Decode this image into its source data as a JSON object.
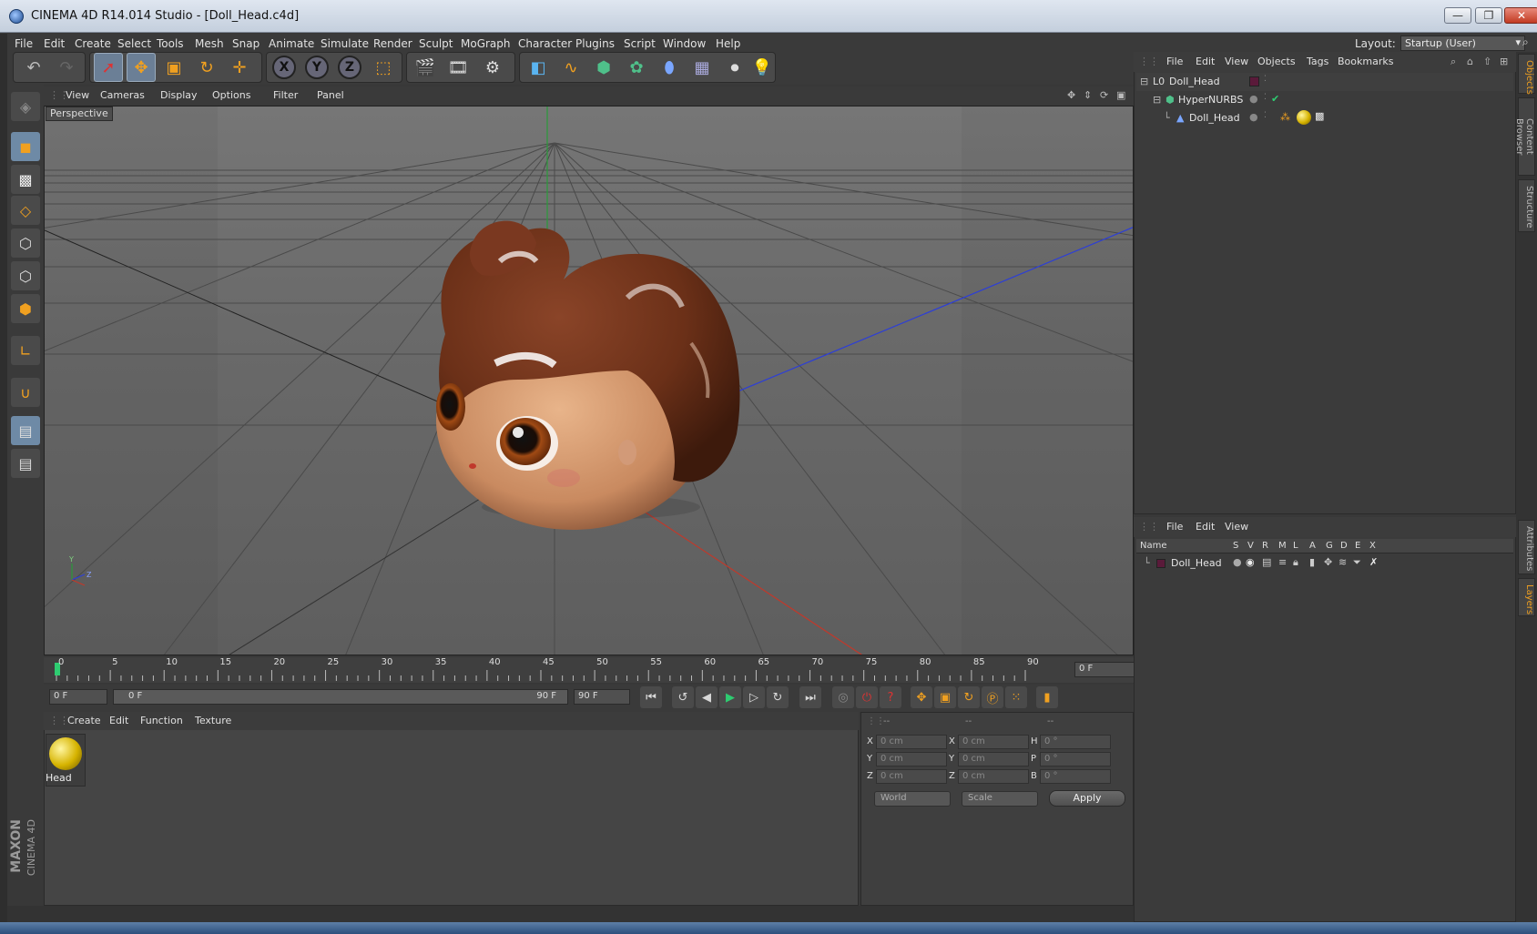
{
  "window": {
    "title": "CINEMA 4D R14.014 Studio - [Doll_Head.c4d]",
    "minimize": "—",
    "restore": "❐",
    "close": "✕"
  },
  "menubar": {
    "items": [
      "File",
      "Edit",
      "Create",
      "Select",
      "Tools",
      "Mesh",
      "Snap",
      "Animate",
      "Simulate",
      "Render",
      "Sculpt",
      "MoGraph",
      "Character",
      "Plugins",
      "Script",
      "Window",
      "Help"
    ],
    "layout_label": "Layout:",
    "layout_value": "Startup (User)"
  },
  "toolbar": {
    "undo_icon": "undo-icon",
    "redo_icon": "redo-icon",
    "axis_x": "X",
    "axis_y": "Y",
    "axis_z": "Z"
  },
  "viewport": {
    "menu": [
      "View",
      "Cameras",
      "Display",
      "Options",
      "Filter",
      "Panel"
    ],
    "label": "Perspective",
    "axis_y": "Y",
    "axis_z": "Z"
  },
  "timeline": {
    "ticks": [
      "0",
      "5",
      "10",
      "15",
      "20",
      "25",
      "30",
      "35",
      "40",
      "45",
      "50",
      "55",
      "60",
      "65",
      "70",
      "75",
      "80",
      "85",
      "90"
    ],
    "current_frame": "0 F"
  },
  "transport": {
    "start_field": "0 F",
    "range_start": "0 F",
    "range_end": "90 F",
    "end_field": "90 F"
  },
  "material_manager": {
    "menu": [
      "Create",
      "Edit",
      "Function",
      "Texture"
    ],
    "materials": [
      {
        "name": "Head"
      }
    ]
  },
  "coordinates": {
    "header": [
      "--",
      "--",
      "--"
    ],
    "rows": [
      {
        "axis": "X",
        "pos": "0 cm",
        "axis2": "X",
        "size": "0 cm",
        "rot_label": "H",
        "rot": "0 °"
      },
      {
        "axis": "Y",
        "pos": "0 cm",
        "axis2": "Y",
        "size": "0 cm",
        "rot_label": "P",
        "rot": "0 °"
      },
      {
        "axis": "Z",
        "pos": "0 cm",
        "axis2": "Z",
        "size": "0 cm",
        "rot_label": "B",
        "rot": "0 °"
      }
    ],
    "mode1": "World",
    "mode2": "Scale",
    "apply": "Apply"
  },
  "object_manager": {
    "menu": [
      "File",
      "Edit",
      "View",
      "Objects",
      "Tags",
      "Bookmarks"
    ],
    "objects": [
      {
        "name": "Doll_Head",
        "level": 0
      },
      {
        "name": "HyperNURBS",
        "level": 1
      },
      {
        "name": "Doll_Head",
        "level": 2
      }
    ]
  },
  "layer_manager": {
    "menu": [
      "File",
      "Edit",
      "View"
    ],
    "columns": [
      "Name",
      "S",
      "V",
      "R",
      "M",
      "L",
      "A",
      "G",
      "D",
      "E",
      "X"
    ],
    "layers": [
      {
        "name": "Doll_Head",
        "color": "#5a1a3a"
      }
    ]
  },
  "right_tabs": [
    "Objects",
    "Content Browser",
    "Structure",
    "Attributes",
    "Layers"
  ],
  "brand": {
    "line1": "MAXON",
    "line2": "CINEMA 4D"
  },
  "colors": {
    "accent": "#f0a020",
    "x_axis": "#c0392b",
    "y_axis": "#27ae60",
    "z_axis": "#2c3ed8",
    "hair": "#6b3018",
    "skin": "#d59a70"
  }
}
